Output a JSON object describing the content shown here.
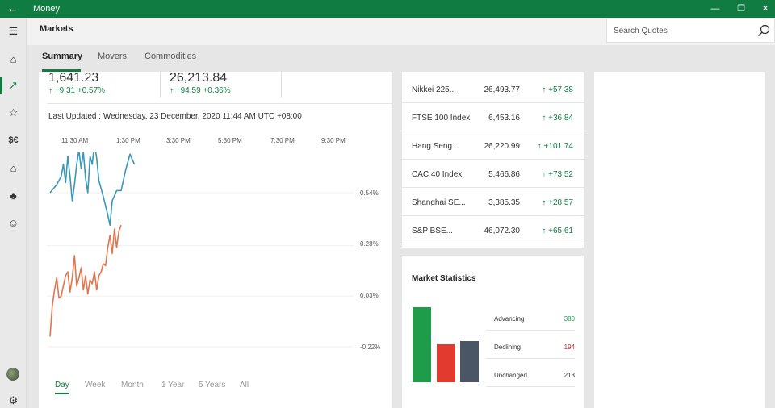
{
  "window": {
    "title": "Money",
    "back_icon": "arrow-left-icon",
    "controls": [
      "minimize-icon",
      "restore-icon",
      "close-icon"
    ]
  },
  "header": {
    "title": "Markets",
    "search_placeholder": "Search Quotes"
  },
  "tabs": [
    {
      "label": "Summary",
      "active": true
    },
    {
      "label": "Movers",
      "active": false
    },
    {
      "label": "Commodities",
      "active": false
    }
  ],
  "nav": [
    {
      "icon": "hamburger-icon",
      "glyph": "☰"
    },
    {
      "icon": "home-icon",
      "glyph": "⌂"
    },
    {
      "icon": "trending-icon",
      "glyph": "↗",
      "active": true
    },
    {
      "icon": "watchlist-icon",
      "glyph": "☆"
    },
    {
      "icon": "currency-icon",
      "glyph": "$€"
    },
    {
      "icon": "mortgage-icon",
      "glyph": "⌂"
    },
    {
      "icon": "piggy-bank-icon",
      "glyph": "♣"
    },
    {
      "icon": "feedback-icon",
      "glyph": "☺"
    },
    {
      "icon": "avatar-icon"
    },
    {
      "icon": "settings-icon",
      "glyph": "⚙"
    }
  ],
  "indices_top": [
    {
      "value": "1,641.23",
      "change": "↑ +9.31 +0.57%"
    },
    {
      "value": "26,213.84",
      "change": "↑ +94.59 +0.36%"
    }
  ],
  "last_updated": "Last Updated : Wednesday, 23 December, 2020 11:44 AM UTC +08:00",
  "time_labels": [
    "11:30 AM",
    "1:30 PM",
    "3:30 PM",
    "5:30 PM",
    "7:30 PM",
    "9:30 PM"
  ],
  "pct_labels": [
    "0.54%",
    "0.28%",
    "0.03%",
    "-0.22%"
  ],
  "ranges": [
    {
      "label": "Day",
      "active": true
    },
    {
      "label": "Week"
    },
    {
      "label": "Month"
    },
    {
      "label": "1 Year"
    },
    {
      "label": "5 Years"
    },
    {
      "label": "All"
    }
  ],
  "chart_data": {
    "type": "line",
    "x_labels": [
      "11:30 AM",
      "1:30 PM",
      "3:30 PM",
      "5:30 PM",
      "7:30 PM",
      "9:30 PM"
    ],
    "y_ticks": [
      "0.54%",
      "0.28%",
      "0.03%",
      "-0.22%"
    ],
    "series": [
      {
        "color": "#3a97b8",
        "points": [
          [
            0,
            0.54
          ],
          [
            3,
            0.58
          ],
          [
            5,
            0.62
          ],
          [
            6,
            0.68
          ],
          [
            7,
            0.59
          ],
          [
            8,
            0.72
          ],
          [
            9,
            0.62
          ],
          [
            10,
            0.5
          ],
          [
            11,
            0.58
          ],
          [
            12,
            0.68
          ],
          [
            13,
            0.75
          ],
          [
            14,
            0.66
          ],
          [
            15,
            0.74
          ],
          [
            16,
            0.61
          ],
          [
            17,
            0.54
          ],
          [
            18,
            0.72
          ],
          [
            19,
            0.68
          ],
          [
            20,
            0.78
          ],
          [
            21,
            0.71
          ],
          [
            22,
            0.6
          ],
          [
            24,
            0.52
          ],
          [
            26,
            0.43
          ],
          [
            27,
            0.38
          ],
          [
            28,
            0.5
          ],
          [
            30,
            0.55
          ],
          [
            32,
            0.55
          ],
          [
            34,
            0.65
          ],
          [
            36,
            0.73
          ],
          [
            38,
            0.68
          ]
        ]
      },
      {
        "color": "#e0764f",
        "points": [
          [
            0,
            -0.17
          ],
          [
            1,
            -0.02
          ],
          [
            2,
            0.06
          ],
          [
            3,
            0.12
          ],
          [
            4,
            0.02
          ],
          [
            5,
            0.03
          ],
          [
            6,
            0.08
          ],
          [
            7,
            0.13
          ],
          [
            8,
            0.15
          ],
          [
            9,
            0.05
          ],
          [
            10,
            0.12
          ],
          [
            11,
            0.23
          ],
          [
            12,
            0.08
          ],
          [
            13,
            0.12
          ],
          [
            14,
            0.17
          ],
          [
            15,
            0.06
          ],
          [
            16,
            0.13
          ],
          [
            17,
            0.04
          ],
          [
            18,
            0.11
          ],
          [
            19,
            0.09
          ],
          [
            20,
            0.15
          ],
          [
            21,
            0.06
          ],
          [
            22,
            0.13
          ],
          [
            23,
            0.15
          ],
          [
            24,
            0.19
          ],
          [
            25,
            0.18
          ],
          [
            26,
            0.27
          ],
          [
            27,
            0.33
          ],
          [
            28,
            0.24
          ],
          [
            29,
            0.36
          ],
          [
            30,
            0.27
          ],
          [
            31,
            0.35
          ],
          [
            32,
            0.38
          ]
        ]
      }
    ]
  },
  "quotes": [
    {
      "name": "Nikkei 225...",
      "value": "26,493.77",
      "change": "↑ +57.38"
    },
    {
      "name": "FTSE 100 Index",
      "value": "6,453.16",
      "change": "↑ +36.84"
    },
    {
      "name": "Hang Seng...",
      "value": "26,220.99",
      "change": "↑ +101.74"
    },
    {
      "name": "CAC 40 Index",
      "value": "5,466.86",
      "change": "↑ +73.52"
    },
    {
      "name": "Shanghai SE...",
      "value": "3,385.35",
      "change": "↑ +28.57"
    },
    {
      "name": "S&P BSE...",
      "value": "46,072.30",
      "change": "↑ +65.61"
    }
  ],
  "market_stats": {
    "title": "Market Statistics",
    "rows": [
      {
        "label": "Advancing",
        "value": "380",
        "color": "#1e9c4a"
      },
      {
        "label": "Declining",
        "value": "194",
        "color": "#e23a2f"
      },
      {
        "label": "Unchanged",
        "value": "213",
        "color": "#4a5566"
      }
    ]
  },
  "colors": {
    "accent": "#107c41",
    "positive": "#107c41",
    "negative": "#c72a2a"
  }
}
